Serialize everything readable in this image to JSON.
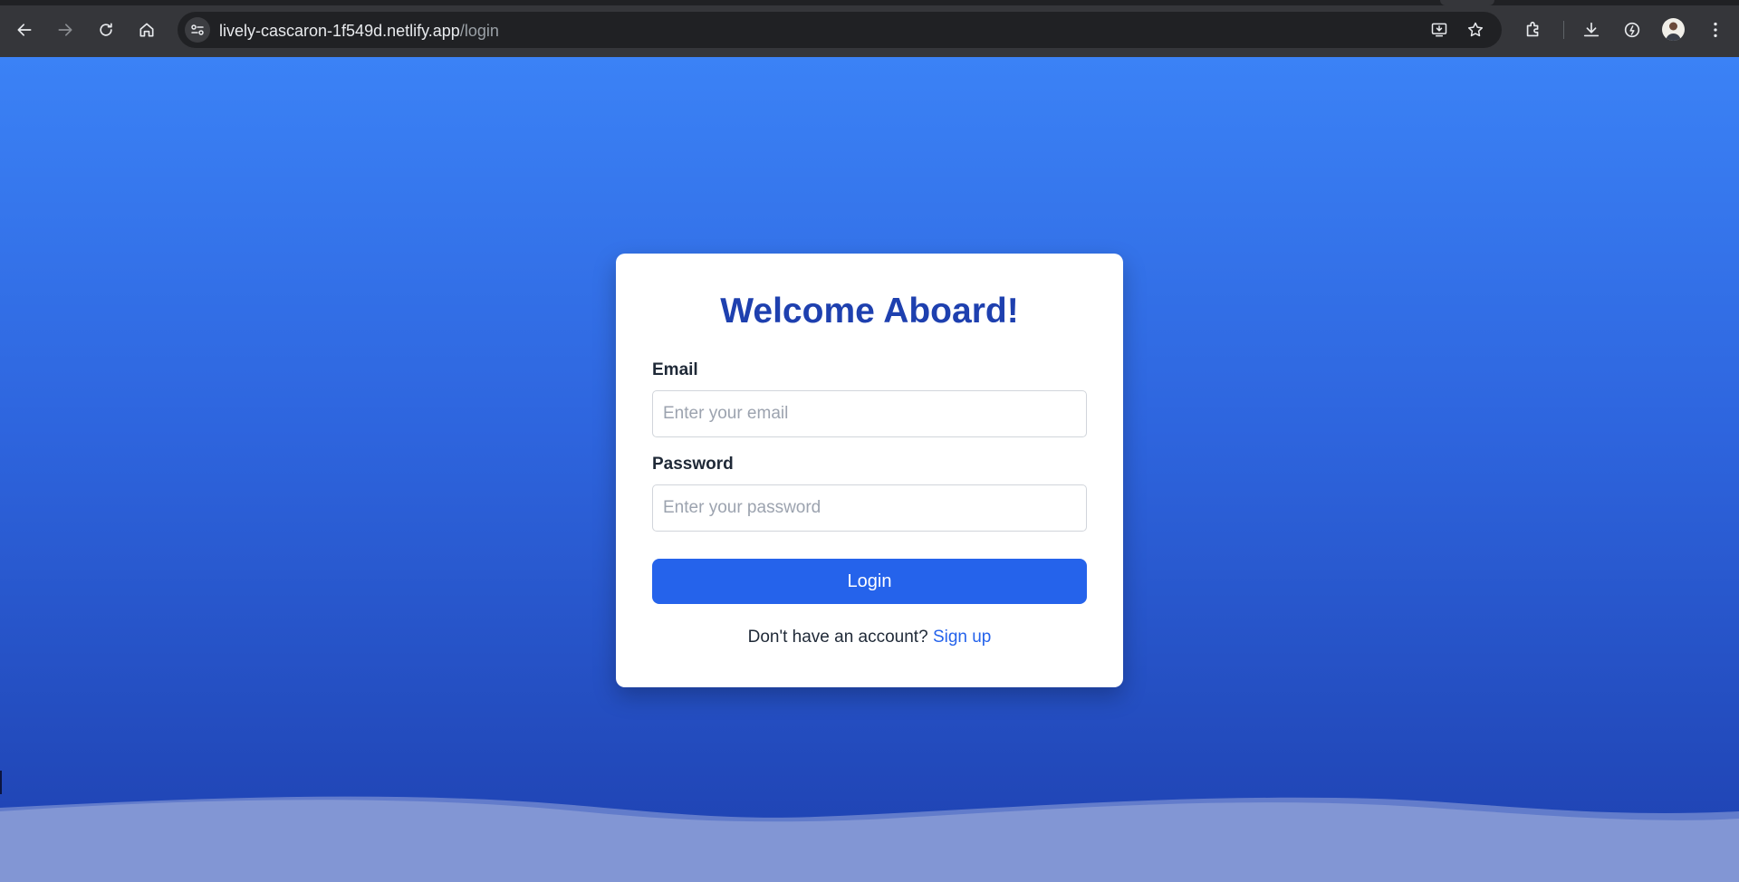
{
  "browser": {
    "url_host": "lively-cascaron-1f549d.netlify.app",
    "url_path": "/login",
    "icons": {
      "back": "back-arrow-icon",
      "forward": "forward-arrow-icon",
      "reload": "reload-icon",
      "home": "home-icon",
      "site_info": "site-info-icon",
      "install_app": "install-app-icon",
      "bookmark": "star-icon",
      "extensions": "puzzle-icon",
      "downloads": "download-icon",
      "performance": "speedometer-icon",
      "profile": "avatar",
      "menu": "kebab-menu-icon"
    }
  },
  "login": {
    "title": "Welcome Aboard!",
    "email_label": "Email",
    "email_placeholder": "Enter your email",
    "email_value": "",
    "password_label": "Password",
    "password_placeholder": "Enter your password",
    "password_value": "",
    "login_button": "Login",
    "signup_prompt": "Don't have an account?",
    "signup_link": "Sign up"
  },
  "colors": {
    "title": "#1e40af",
    "button": "#2563eb",
    "link": "#2563eb",
    "background_top": "#3b82f6",
    "background_bottom": "#1e40af",
    "wave": "#8296d4"
  }
}
